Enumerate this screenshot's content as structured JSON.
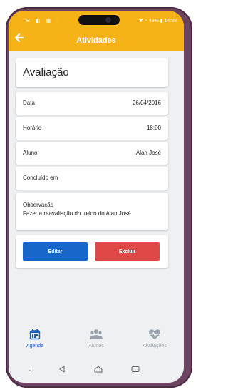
{
  "status": {
    "left_icons": "✉ ◧ ▦ ·",
    "right": "✱ ◔ 49% ▮ 14:58"
  },
  "appbar": {
    "title": "Atividades",
    "back_icon": "arrow-left-icon"
  },
  "card": {
    "title": "Avaliação"
  },
  "fields": [
    {
      "label": "Data",
      "value": "26/04/2016"
    },
    {
      "label": "Horário",
      "value": "18:00"
    },
    {
      "label": "Aluno",
      "value": "Alan José"
    },
    {
      "label": "Concluído em",
      "value": ""
    }
  ],
  "observacao": {
    "label": "Observação",
    "text": "Fazer a reavaliação do treino do Alan José"
  },
  "actions": {
    "edit_label": "Editar",
    "delete_label": "Excluir",
    "edit_color": "#1667c9",
    "delete_color": "#e04848"
  },
  "tabs": [
    {
      "label": "Agenda",
      "icon": "calendar-icon",
      "active": true
    },
    {
      "label": "Alunos",
      "icon": "users-icon",
      "active": false
    },
    {
      "label": "Avaliações",
      "icon": "heartbeat-icon",
      "active": false
    }
  ],
  "colors": {
    "accent": "#f5b317",
    "active_tab": "#1c5fb9",
    "inactive_tab": "#9aa3ad"
  }
}
